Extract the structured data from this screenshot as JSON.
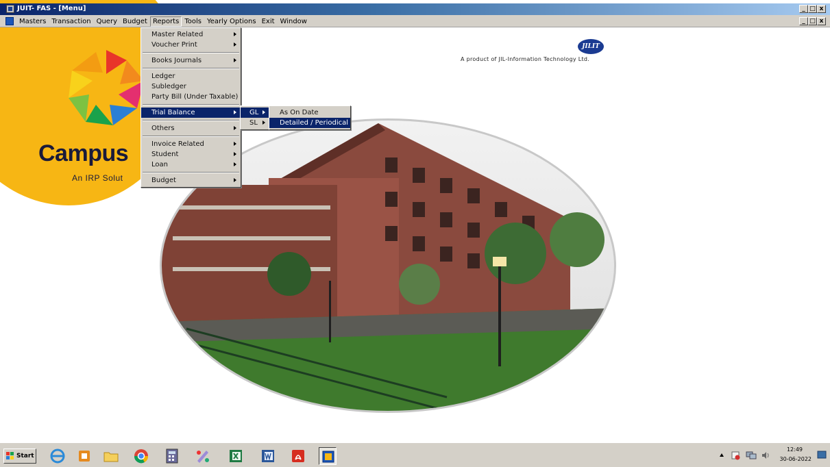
{
  "window": {
    "title": "JUIT- FAS - [Menu]",
    "controls": [
      "_",
      "□",
      "x"
    ]
  },
  "menubar": {
    "items": [
      "Masters",
      "Transaction",
      "Query",
      "Budget",
      "Reports",
      "Tools",
      "Yearly Options",
      "Exit",
      "Window"
    ],
    "active": "Reports"
  },
  "reports_menu": {
    "items": [
      {
        "label": "Master Related",
        "submenu": true
      },
      {
        "label": "Voucher Print",
        "submenu": true
      },
      {
        "separator": true
      },
      {
        "label": "Books  Journals",
        "submenu": true
      },
      {
        "separator": true
      },
      {
        "label": "Ledger",
        "submenu": false
      },
      {
        "label": "Subledger",
        "submenu": false
      },
      {
        "label": "Party Bill (Under Taxable)",
        "submenu": false
      },
      {
        "separator": true
      },
      {
        "label": "Trial Balance",
        "submenu": true,
        "selected": true
      },
      {
        "separator": true
      },
      {
        "label": "Others",
        "submenu": true
      },
      {
        "separator": true
      },
      {
        "label": "Invoice Related",
        "submenu": true
      },
      {
        "label": "Student",
        "submenu": true
      },
      {
        "label": "Loan",
        "submenu": true
      },
      {
        "separator": true
      },
      {
        "label": "Budget",
        "submenu": true
      }
    ]
  },
  "trial_balance_menu": {
    "items": [
      {
        "label": "GL",
        "submenu": true,
        "selected": true
      },
      {
        "label": "SL",
        "submenu": true,
        "selected": false
      }
    ]
  },
  "gl_menu": {
    "items": [
      {
        "label": "As On Date",
        "selected": false
      },
      {
        "label": "Detailed / Periodical",
        "selected": true
      }
    ]
  },
  "branding": {
    "campus_text": "Campus",
    "campus_sub": "An IRP Solut",
    "jiit_logo": "JILIT",
    "product_text": "A product of JIL-Information Technology Ltd."
  },
  "taskbar": {
    "start_label": "Start",
    "apps": [
      {
        "icon": "ie-icon"
      },
      {
        "icon": "outlook-icon"
      },
      {
        "icon": "folder-icon"
      },
      {
        "icon": "chrome-icon"
      },
      {
        "icon": "calculator-icon"
      },
      {
        "icon": "paint-icon"
      },
      {
        "icon": "excel-icon"
      },
      {
        "icon": "word-icon"
      },
      {
        "icon": "acrobat-icon"
      },
      {
        "icon": "fas-app-icon",
        "active": true
      }
    ],
    "clock_time": "12:49",
    "clock_date": "30-06-2022"
  },
  "colors": {
    "menu_highlight": "#0a246a",
    "title_gradient_start": "#0a246a",
    "campus_yellow": "#f7b614"
  }
}
